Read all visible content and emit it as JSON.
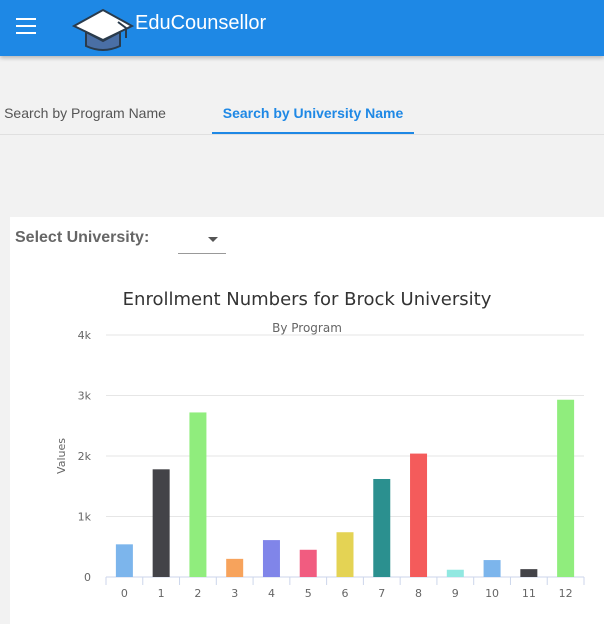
{
  "appbar": {
    "title": "EduCounsellor",
    "menu_icon": "hamburger-menu-icon",
    "logo_icon": "graduation-cap-icon",
    "color": "#1e88e5"
  },
  "tabs": [
    {
      "label": "Search by Program Name",
      "active": false
    },
    {
      "label": "Search by University Name",
      "active": true
    }
  ],
  "filter": {
    "label": "Select University:",
    "selected": ""
  },
  "chart_data": {
    "type": "bar",
    "title": "Enrollment Numbers for Brock University",
    "subtitle": "By Program",
    "xlabel": "",
    "ylabel": "Values",
    "ylim": [
      0,
      4000
    ],
    "yticks": [
      0,
      1000,
      2000,
      3000,
      4000
    ],
    "ytick_labels": [
      "0",
      "1k",
      "2k",
      "3k",
      "4k"
    ],
    "grid": true,
    "categories": [
      "0",
      "1",
      "2",
      "3",
      "4",
      "5",
      "6",
      "7",
      "8",
      "9",
      "10",
      "11",
      "12"
    ],
    "values": [
      540,
      1780,
      2720,
      300,
      610,
      450,
      740,
      1620,
      2040,
      120,
      280,
      130,
      2930
    ],
    "colors": [
      "#7cb5ec",
      "#434348",
      "#90ed7d",
      "#f7a35c",
      "#8085e9",
      "#f15c80",
      "#e4d354",
      "#2b908f",
      "#f45b5b",
      "#91e8e1",
      "#7cb5ec",
      "#434348",
      "#90ed7d"
    ]
  }
}
